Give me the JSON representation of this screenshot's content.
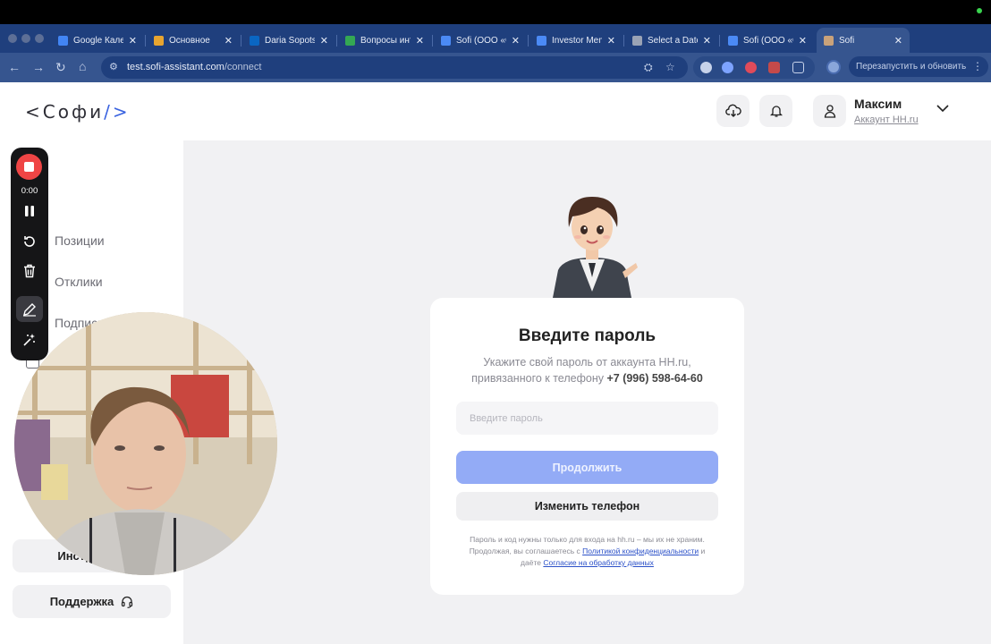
{
  "browser": {
    "tabs": [
      {
        "title": "Google Кален",
        "favicon_color": "#4285f4",
        "active": false
      },
      {
        "title": "Основное",
        "favicon_color": "#e8a530",
        "active": false
      },
      {
        "title": "Daria Sopots",
        "favicon_color": "#0a66c2",
        "active": false
      },
      {
        "title": "Вопросы инт",
        "favicon_color": "#34a853",
        "active": false
      },
      {
        "title": "Sofi (ООО «С",
        "favicon_color": "#4b8af5",
        "active": false
      },
      {
        "title": "Investor Mem",
        "favicon_color": "#4b8af5",
        "active": false
      },
      {
        "title": "Select a Date",
        "favicon_color": "#9aa3b5",
        "active": false
      },
      {
        "title": "Sofi (ООО «С",
        "favicon_color": "#4b8af5",
        "active": false
      },
      {
        "title": "Sofi",
        "favicon_color": "#c9a27a",
        "active": true
      }
    ],
    "url_host": "test.sofi-assistant.com",
    "url_path": "/connect",
    "relaunch_label": "Перезапустить и обновить"
  },
  "header": {
    "logo_left": "<",
    "logo_text": "Софи",
    "logo_right": "/>",
    "user_name": "Максим",
    "user_account": "Аккаунт HH.ru"
  },
  "sidebar": {
    "items": [
      "Позиции",
      "Отклики",
      "Подписка"
    ],
    "instructions_label": "Инструкции",
    "support_label": "Поддержка"
  },
  "card": {
    "title": "Введите пароль",
    "desc_line1": "Укажите свой пароль от аккаунта HH.ru,",
    "desc_line2": "привязанного к телефону",
    "phone": "+7 (996) 598-64-60",
    "password_placeholder": "Введите пароль",
    "continue_label": "Продолжить",
    "change_phone_label": "Изменить телефон",
    "legal_line1": "Пароль и код нужны только для входа на hh.ru – мы их не храним.",
    "legal_prefix": "Продолжая, вы соглашаетесь с",
    "legal_privacy": "Политикой конфиденциальности",
    "legal_and": "и",
    "legal_consent_prefix": "даёте",
    "legal_consent": "Согласие на обработку данных"
  },
  "recorder": {
    "time": "0:00"
  },
  "colors": {
    "accent": "#3a63e0",
    "primary_button": "#93abf6",
    "browser_chrome": "#36558f",
    "record": "#ef4545"
  }
}
